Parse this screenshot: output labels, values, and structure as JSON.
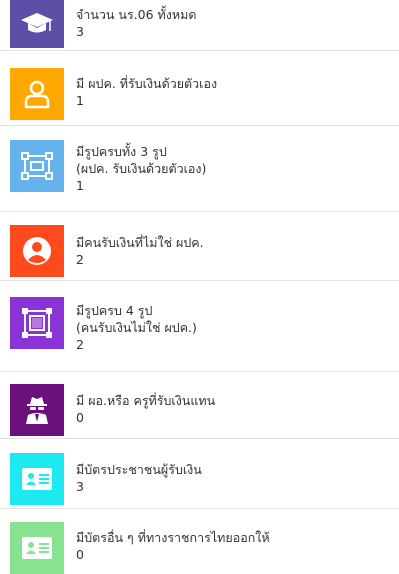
{
  "colors": {
    "purple": "#5c4fa8",
    "orange": "#ffa800",
    "lightblue": "#65b3ec",
    "red": "#ff4a1c",
    "violet": "#8b34d6",
    "darkpurple": "#6b117c",
    "cyan": "#1de9f0",
    "lightgreen": "#87e38f"
  },
  "items": [
    {
      "icon": "graduation-cap-icon",
      "lines": [
        "จำนวน นร.06 ทั้งหมด"
      ],
      "count": "3"
    },
    {
      "icon": "user-outline-icon",
      "lines": [
        "มี ผปค. ที่รับเงินด้วยตัวเอง"
      ],
      "count": "1"
    },
    {
      "icon": "selection-frame-icon",
      "lines": [
        "มีรูปครบทั้ง 3 รูป",
        "(ผปค. รับเงินด้วยตัวเอง)"
      ],
      "count": "1"
    },
    {
      "icon": "user-circle-icon",
      "lines": [
        "มีคนรับเงินที่ไม่ใช่ ผปค."
      ],
      "count": "2"
    },
    {
      "icon": "object-group-icon",
      "lines": [
        "มีรูปครบ 4 รูป",
        "(คนรับเงินไม่ใช่ ผปค.)"
      ],
      "count": "2"
    },
    {
      "icon": "user-secret-icon",
      "lines": [
        "มี ผอ.หรือ ครูที่รับเงินแทน"
      ],
      "count": "0"
    },
    {
      "icon": "id-card-icon",
      "lines": [
        "มีบัตรประชาชนผู้รับเงิน"
      ],
      "count": "3"
    },
    {
      "icon": "id-badge-icon",
      "lines": [
        "มีบัตรอื่น ๆ ที่ทางราชการไทยออกให้"
      ],
      "count": "0"
    }
  ]
}
